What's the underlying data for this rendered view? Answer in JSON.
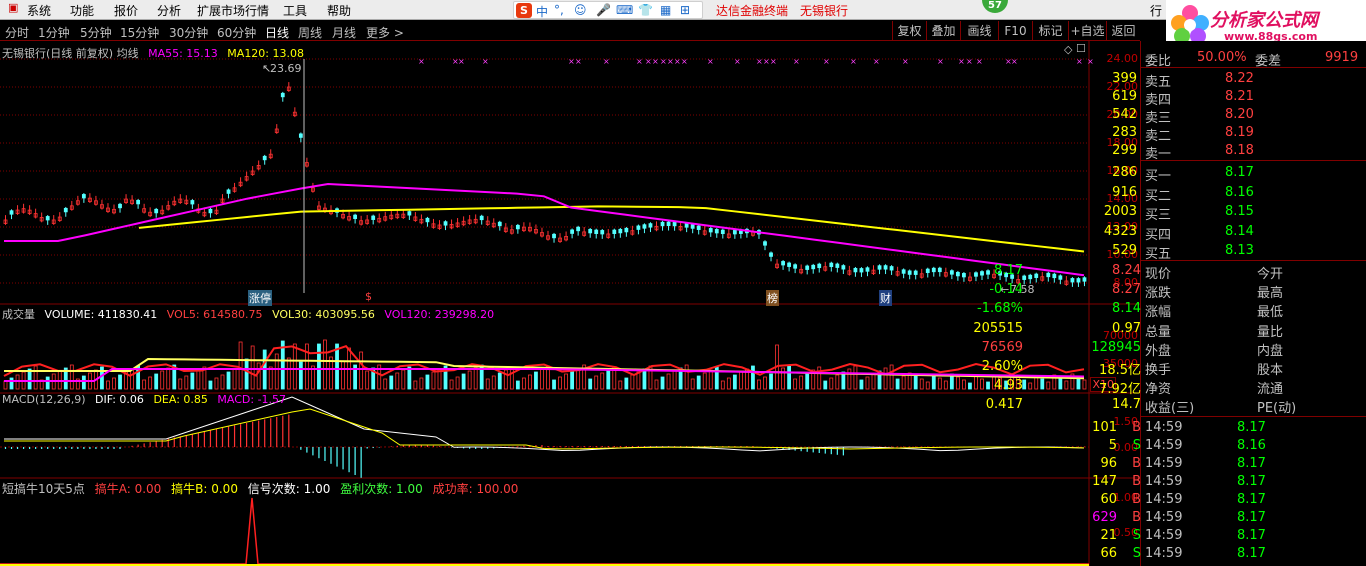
{
  "menu": [
    "系统",
    "功能",
    "报价",
    "分析",
    "扩展市场行情",
    "工具",
    "帮助"
  ],
  "ime": {
    "label": "中"
  },
  "ticker": {
    "broker": "达信金融终端",
    "stock": "无锡银行"
  },
  "badge": "57",
  "corner": "行",
  "logo": {
    "name": "分析家公式网",
    "url": "www.88gs.com"
  },
  "periods": [
    "分时",
    "1分钟",
    "5分钟",
    "15分钟",
    "30分钟",
    "60分钟",
    "日线",
    "周线",
    "月线",
    "更多 >"
  ],
  "active_period": "日线",
  "tools": [
    "复权",
    "叠加",
    "画线",
    "F10",
    "标记",
    "+自选",
    "返回"
  ],
  "price_panel": {
    "title": "无锡银行(日线 前复权) 均线",
    "ma55_label": "MA55: 15.13",
    "ma120_label": "MA120: 13.08",
    "high_mark": "23.69",
    "low_mark": "7.58",
    "yaxis": [
      "24.00",
      "22.00",
      "20.00",
      "18.00",
      "16.00",
      "14.00",
      "12.00",
      "10.00",
      "8.00"
    ],
    "tags": [
      "涨停",
      "$",
      "榜",
      "财"
    ]
  },
  "vol_panel": {
    "title": "成交量",
    "vol": "VOLUME: 411830.41",
    "vol5": "VOL5: 614580.75",
    "vol30": "VOL30: 403095.56",
    "vol120": "VOL120: 239298.20",
    "yaxis": [
      "70000",
      "35000"
    ],
    "unit": "X10"
  },
  "macd_panel": {
    "title": "MACD(12,26,9)",
    "dif": "DIF: 0.06",
    "dea": "DEA: 0.85",
    "macd": "MACD: -1.57",
    "yaxis": [
      "1.50",
      "0.00"
    ]
  },
  "ind_panel": {
    "title": "短搞牛10天5点",
    "a": "搞牛A: 0.00",
    "b": "搞牛B: 0.00",
    "sig": "信号次数: 1.00",
    "win": "盈利次数: 1.00",
    "rate": "成功率: 100.00",
    "yaxis": [
      "1.00",
      "0.50"
    ]
  },
  "quote": {
    "header_left": "委比",
    "header_left_val": "50.00%",
    "header_right": "委差",
    "header_right_val": "9919",
    "asks": [
      {
        "l": "卖五",
        "p": "8.22",
        "v": "399"
      },
      {
        "l": "卖四",
        "p": "8.21",
        "v": "619"
      },
      {
        "l": "卖三",
        "p": "8.20",
        "v": "542"
      },
      {
        "l": "卖二",
        "p": "8.19",
        "v": "283"
      },
      {
        "l": "卖一",
        "p": "8.18",
        "v": "299"
      }
    ],
    "bids": [
      {
        "l": "买一",
        "p": "8.17",
        "v": "286"
      },
      {
        "l": "买二",
        "p": "8.16",
        "v": "916"
      },
      {
        "l": "买三",
        "p": "8.15",
        "v": "2003"
      },
      {
        "l": "买四",
        "p": "8.14",
        "v": "4323"
      },
      {
        "l": "买五",
        "p": "8.13",
        "v": "529"
      }
    ],
    "stats": [
      {
        "l1": "现价",
        "v1": "8.17",
        "l2": "今开",
        "v2": "8.24"
      },
      {
        "l1": "涨跌",
        "v1": "-0.14",
        "l2": "最高",
        "v2": "8.27"
      },
      {
        "l1": "涨幅",
        "v1": "-1.68%",
        "l2": "最低",
        "v2": "8.14"
      },
      {
        "l1": "总量",
        "v1": "205515",
        "l2": "量比",
        "v2": "0.97"
      },
      {
        "l1": "外盘",
        "v1": "76569",
        "l2": "内盘",
        "v2": "128945"
      },
      {
        "l1": "换手",
        "v1": "2.60%",
        "l2": "股本",
        "v2": "18.5亿"
      },
      {
        "l1": "净资",
        "v1": "4.93",
        "l2": "流通",
        "v2": "7.92亿"
      },
      {
        "l1": "收益(三)",
        "v1": "0.417",
        "l2": "PE(动)",
        "v2": "14.7"
      }
    ],
    "ticks": [
      {
        "t": "14:59",
        "p": "8.17",
        "v": "101",
        "d": "B"
      },
      {
        "t": "14:59",
        "p": "8.16",
        "v": "5",
        "d": "S"
      },
      {
        "t": "14:59",
        "p": "8.17",
        "v": "96",
        "d": "B"
      },
      {
        "t": "14:59",
        "p": "8.17",
        "v": "147",
        "d": "B"
      },
      {
        "t": "14:59",
        "p": "8.17",
        "v": "60",
        "d": "B"
      },
      {
        "t": "14:59",
        "p": "8.17",
        "v": "629",
        "d": "B"
      },
      {
        "t": "14:59",
        "p": "8.17",
        "v": "21",
        "d": "S"
      },
      {
        "t": "14:59",
        "p": "8.17",
        "v": "66",
        "d": "S"
      }
    ]
  },
  "colors": {
    "up": "#ff3232",
    "down": "#54ffff",
    "ma55": "#ff00ff",
    "ma120": "#ffff00",
    "frame": "#800000",
    "axis": "#c00000"
  }
}
